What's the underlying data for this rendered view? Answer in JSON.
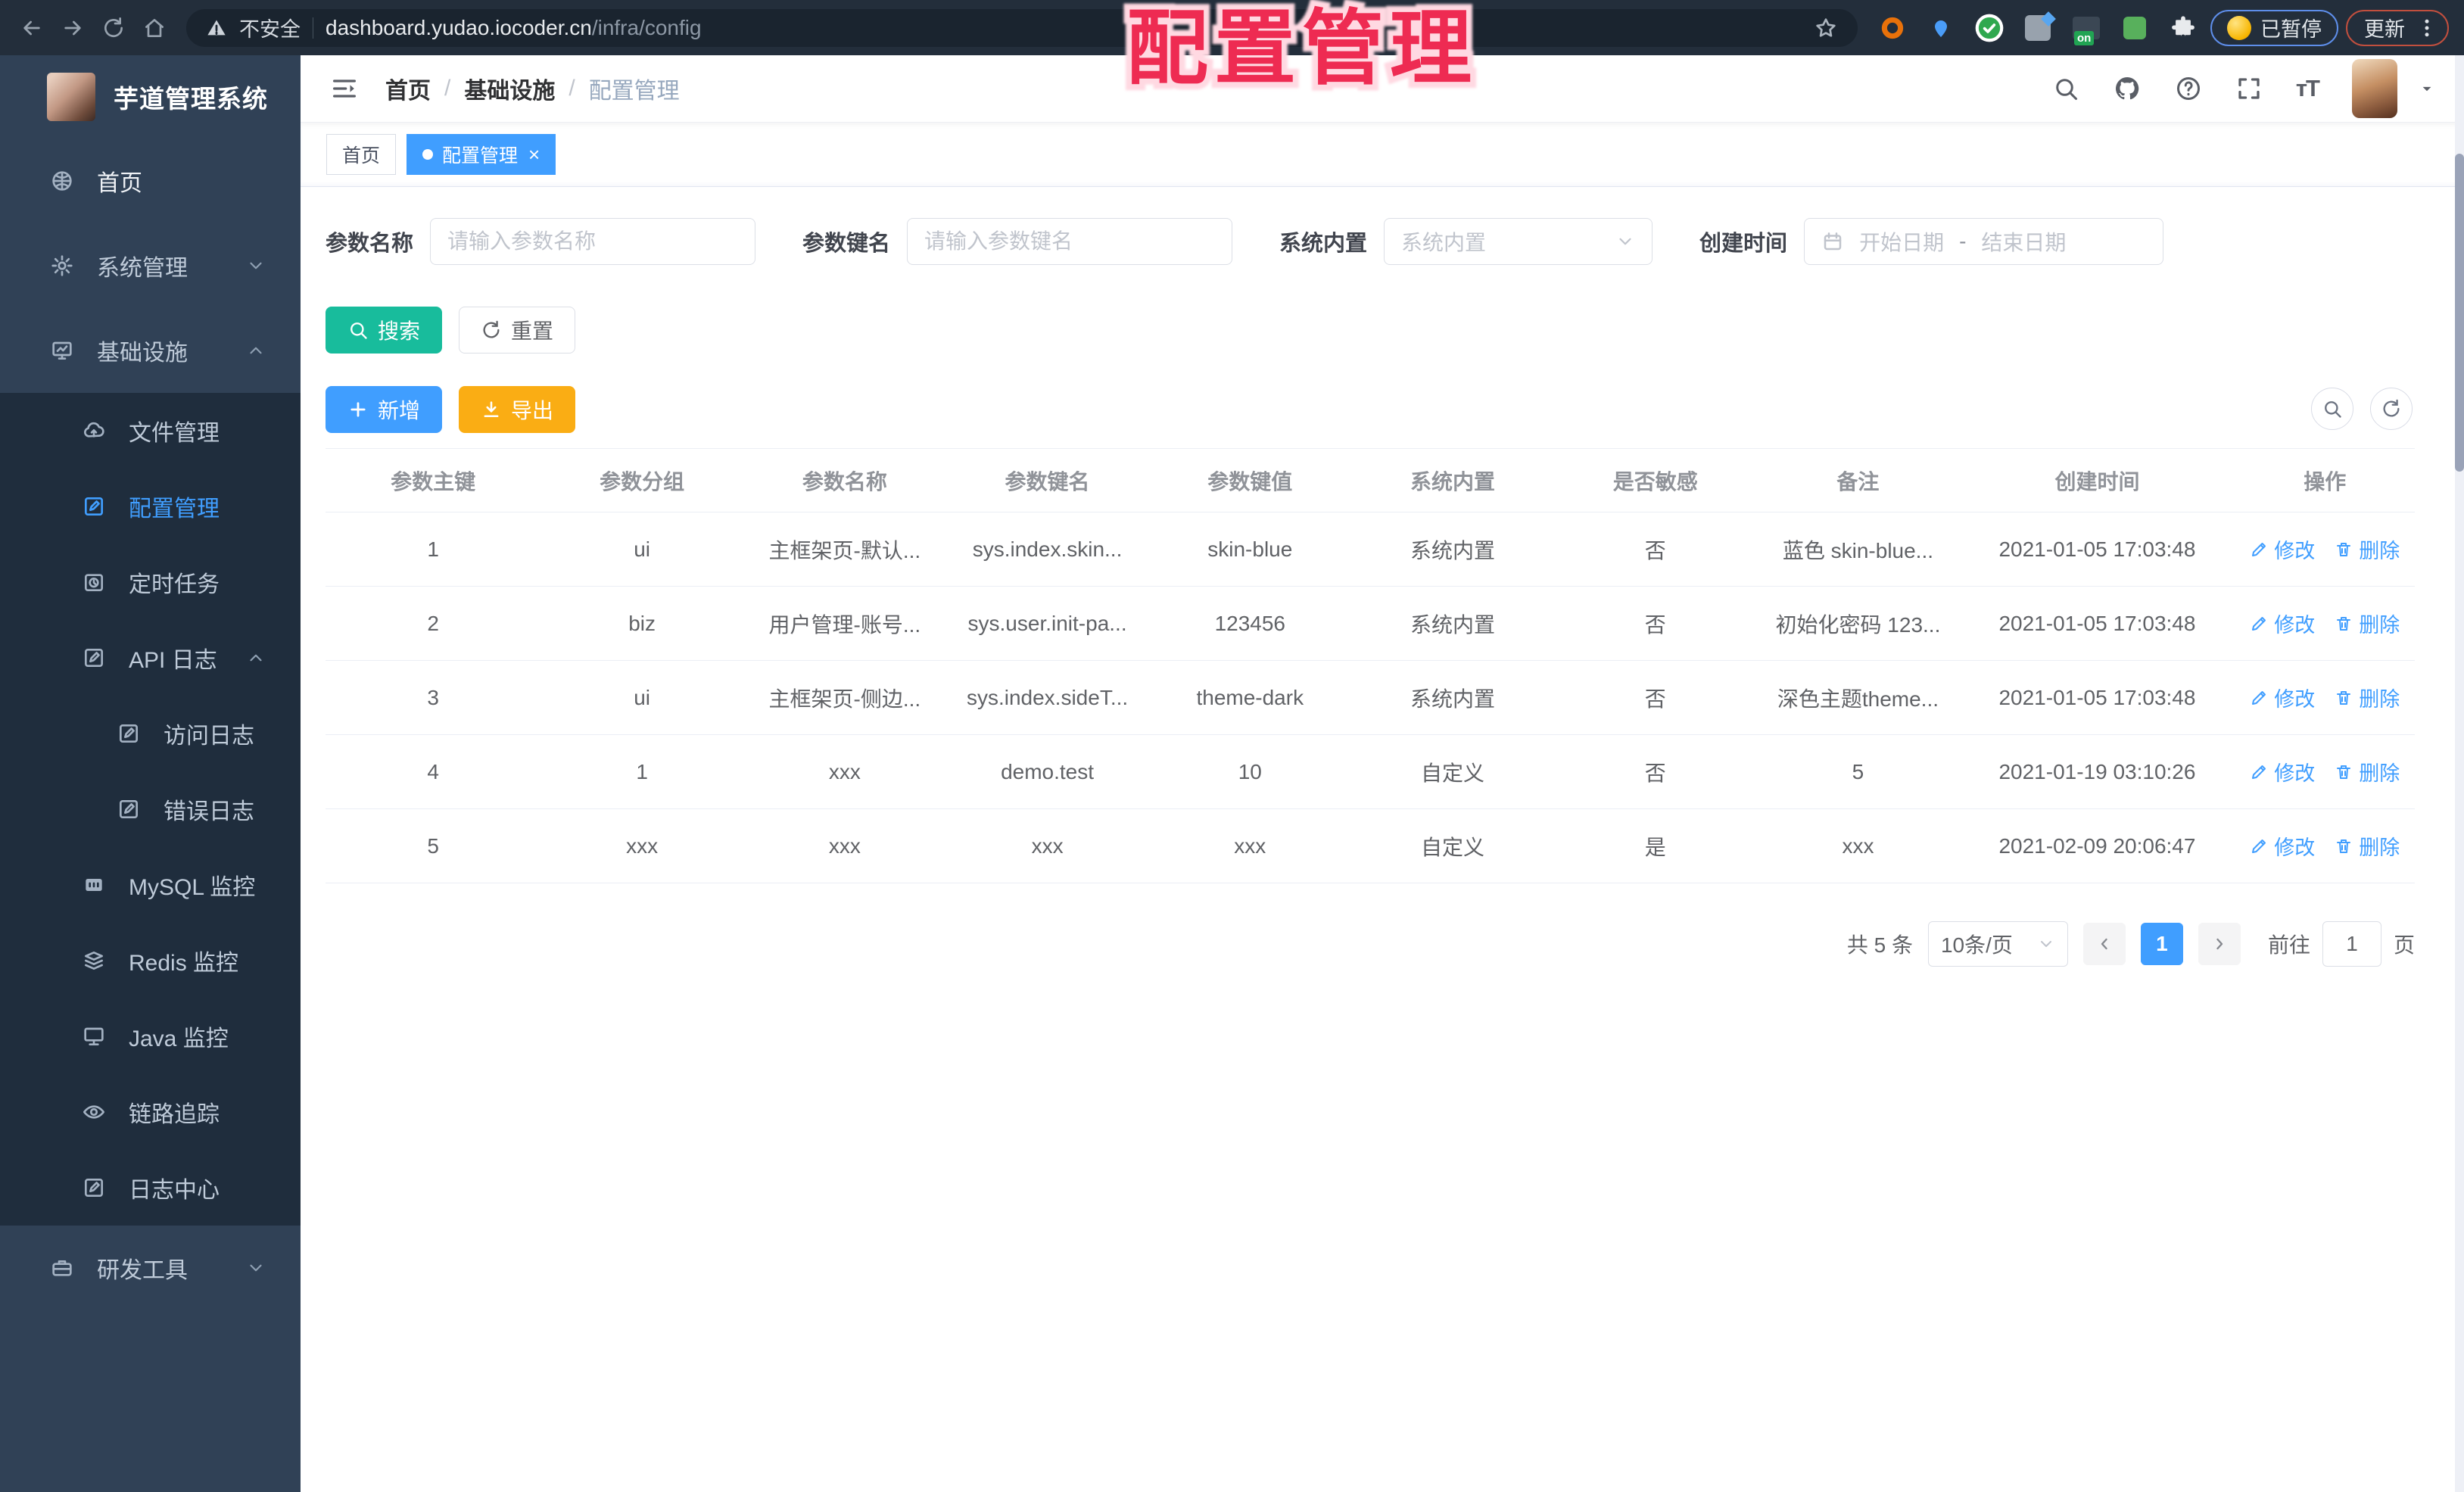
{
  "overlay": {
    "title": "配置管理"
  },
  "colors": {
    "accent": "#409eff",
    "search_button": "#18bc9c",
    "export_button": "#faad14",
    "sidebar_bg": "#304156",
    "sidebar_submenu_bg": "#1f2d3d",
    "tab_active": "#409eff",
    "overlay_red": "#ee2b52"
  },
  "browser": {
    "security_label": "不安全",
    "url_host": "dashboard.yudao.iocoder.cn",
    "url_path": "/infra/config",
    "paused_badge": "已暂停",
    "update_button": "更新"
  },
  "sidebar": {
    "app_title": "芋道管理系统",
    "items": [
      {
        "id": "home",
        "label": "首页",
        "icon": "dashboard-icon",
        "iconKey": "dashboard",
        "level": 1,
        "bright": true
      },
      {
        "id": "system",
        "label": "系统管理",
        "icon": "gear-icon",
        "iconKey": "gear",
        "level": 1,
        "chevron": "down"
      },
      {
        "id": "infra",
        "label": "基础设施",
        "icon": "monitor-chart-icon",
        "iconKey": "infra",
        "level": 1,
        "chevron": "up"
      },
      {
        "id": "file",
        "label": "文件管理",
        "icon": "cloud-upload-icon",
        "iconKey": "cloud",
        "level": 2
      },
      {
        "id": "config",
        "label": "配置管理",
        "icon": "edit-square-icon",
        "iconKey": "editsq",
        "level": 2,
        "active": true
      },
      {
        "id": "job",
        "label": "定时任务",
        "icon": "timer-icon",
        "iconKey": "timer",
        "level": 2
      },
      {
        "id": "api-log",
        "label": "API 日志",
        "icon": "log-icon",
        "iconKey": "log",
        "level": 2,
        "chevron": "up"
      },
      {
        "id": "access-log",
        "label": "访问日志",
        "icon": "log-icon",
        "iconKey": "log",
        "level": 3
      },
      {
        "id": "error-log",
        "label": "错误日志",
        "icon": "log-icon",
        "iconKey": "log",
        "level": 3
      },
      {
        "id": "mysql",
        "label": "MySQL 监控",
        "icon": "mysql-icon",
        "iconKey": "mysql",
        "level": 2
      },
      {
        "id": "redis",
        "label": "Redis 监控",
        "icon": "redis-icon",
        "iconKey": "redis",
        "level": 2
      },
      {
        "id": "java",
        "label": "Java 监控",
        "icon": "java-monitor-icon",
        "iconKey": "java",
        "level": 2
      },
      {
        "id": "tracer",
        "label": "链路追踪",
        "icon": "eye-icon",
        "iconKey": "eye",
        "level": 2
      },
      {
        "id": "log-center",
        "label": "日志中心",
        "icon": "log-icon",
        "iconKey": "log",
        "level": 2
      },
      {
        "id": "dev-tools",
        "label": "研发工具",
        "icon": "briefcase-icon",
        "iconKey": "tools",
        "level": 1,
        "chevron": "down"
      }
    ]
  },
  "header": {
    "breadcrumb": [
      "首页",
      "基础设施",
      "配置管理"
    ]
  },
  "tabs": [
    {
      "label": "首页",
      "active": false,
      "closable": false
    },
    {
      "label": "配置管理",
      "active": true,
      "closable": true
    }
  ],
  "filters": {
    "name_label": "参数名称",
    "name_placeholder": "请输入参数名称",
    "key_label": "参数键名",
    "key_placeholder": "请输入参数键名",
    "type_label": "系统内置",
    "type_placeholder": "系统内置",
    "date_label": "创建时间",
    "date_start_placeholder": "开始日期",
    "date_separator": "-",
    "date_end_placeholder": "结束日期",
    "search_button": "搜索",
    "reset_button": "重置"
  },
  "toolbar": {
    "add_button": "新增",
    "export_button": "导出"
  },
  "table": {
    "columns": [
      "参数主键",
      "参数分组",
      "参数名称",
      "参数键名",
      "参数键值",
      "系统内置",
      "是否敏感",
      "备注",
      "创建时间",
      "操作"
    ],
    "actions": {
      "edit_label": "修改",
      "delete_label": "删除"
    },
    "rows": [
      [
        "1",
        "ui",
        "主框架页-默认...",
        "sys.index.skin...",
        "skin-blue",
        "系统内置",
        "否",
        "蓝色 skin-blue...",
        "2021-01-05 17:03:48"
      ],
      [
        "2",
        "biz",
        "用户管理-账号...",
        "sys.user.init-pa...",
        "123456",
        "系统内置",
        "否",
        "初始化密码 123...",
        "2021-01-05 17:03:48"
      ],
      [
        "3",
        "ui",
        "主框架页-侧边...",
        "sys.index.sideT...",
        "theme-dark",
        "系统内置",
        "否",
        "深色主题theme...",
        "2021-01-05 17:03:48"
      ],
      [
        "4",
        "1",
        "xxx",
        "demo.test",
        "10",
        "自定义",
        "否",
        "5",
        "2021-01-19 03:10:26"
      ],
      [
        "5",
        "xxx",
        "xxx",
        "xxx",
        "xxx",
        "自定义",
        "是",
        "xxx",
        "2021-02-09 20:06:47"
      ]
    ]
  },
  "pagination": {
    "total_text": "共 5 条",
    "page_size": "10条/页",
    "pages": [
      "1"
    ],
    "current_page": "1",
    "goto_label": "前往",
    "goto_value": "1",
    "page_suffix": "页"
  }
}
